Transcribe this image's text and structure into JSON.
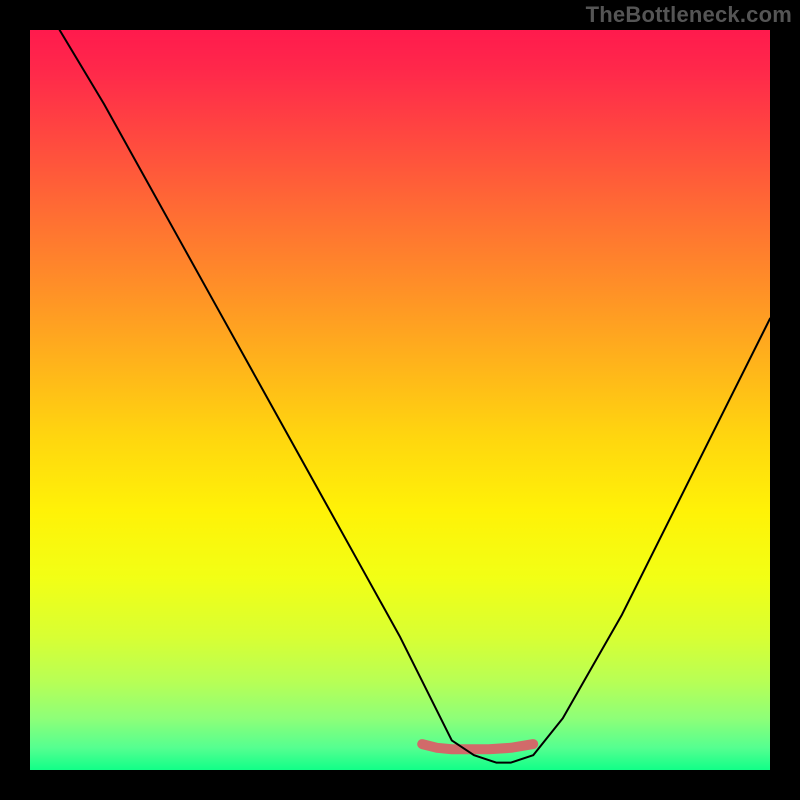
{
  "watermark": "TheBottleneck.com",
  "gradient": {
    "stops": [
      {
        "offset": 0.0,
        "color": "#ff1a4d"
      },
      {
        "offset": 0.06,
        "color": "#ff2a4a"
      },
      {
        "offset": 0.15,
        "color": "#ff4a3f"
      },
      {
        "offset": 0.25,
        "color": "#ff6e33"
      },
      {
        "offset": 0.35,
        "color": "#ff9027"
      },
      {
        "offset": 0.45,
        "color": "#ffb31b"
      },
      {
        "offset": 0.55,
        "color": "#ffd60f"
      },
      {
        "offset": 0.65,
        "color": "#fff207"
      },
      {
        "offset": 0.74,
        "color": "#f2ff15"
      },
      {
        "offset": 0.82,
        "color": "#d8ff33"
      },
      {
        "offset": 0.88,
        "color": "#b8ff55"
      },
      {
        "offset": 0.93,
        "color": "#8eff78"
      },
      {
        "offset": 0.97,
        "color": "#55ff90"
      },
      {
        "offset": 1.0,
        "color": "#11ff88"
      }
    ]
  },
  "chart_data": {
    "type": "line",
    "title": "",
    "xlabel": "",
    "ylabel": "",
    "xlim": [
      0,
      100
    ],
    "ylim": [
      0,
      100
    ],
    "grid": false,
    "series": [
      {
        "name": "curve",
        "x": [
          4,
          10,
          15,
          20,
          25,
          30,
          35,
          40,
          45,
          50,
          53,
          55,
          57,
          60,
          63,
          65,
          68,
          72,
          76,
          80,
          85,
          90,
          95,
          100
        ],
        "values": [
          100,
          90,
          81,
          72,
          63,
          54,
          45,
          36,
          27,
          18,
          12,
          8,
          4,
          2,
          1,
          1,
          2,
          7,
          14,
          21,
          31,
          41,
          51,
          61
        ]
      },
      {
        "name": "flat-highlight",
        "x": [
          53,
          55,
          57,
          62,
          65,
          68
        ],
        "values": [
          3.5,
          3,
          2.8,
          2.8,
          3,
          3.5
        ]
      }
    ],
    "annotations": []
  },
  "styling": {
    "curve_color": "#000000",
    "curve_width": 2,
    "highlight_color": "#d16a6a",
    "highlight_width": 10
  }
}
